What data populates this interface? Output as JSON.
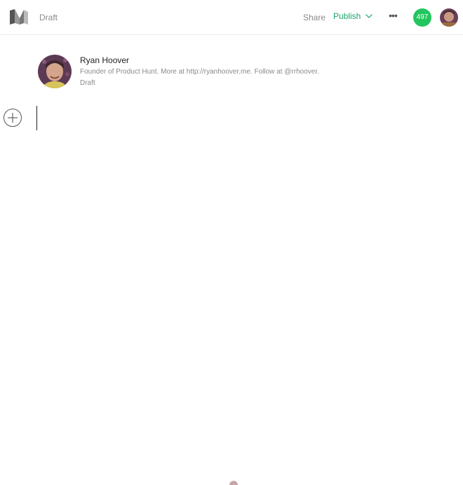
{
  "header": {
    "status": "Draft",
    "share_label": "Share",
    "publish_label": "Publish",
    "more_label": "•••",
    "notification_count": "497",
    "accent_color": "#1aa36b",
    "badge_color": "#23c65e"
  },
  "author": {
    "name": "Ryan Hoover",
    "bio": "Founder of Product Hunt. More at http://ryanhoover.me. Follow at @rrhoover.",
    "status": "Draft"
  },
  "icons": {
    "logo": "medium-logo-icon",
    "publish_dropdown": "chevron-down-icon",
    "add": "plus-icon",
    "avatar": "avatar"
  }
}
